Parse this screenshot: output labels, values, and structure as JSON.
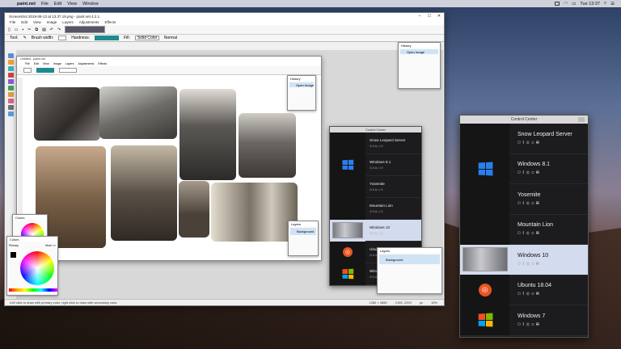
{
  "menubar": {
    "app": "paint.net",
    "items": [
      "File",
      "Edit",
      "View",
      "Window"
    ],
    "clock": "Tue 13:37"
  },
  "pdn": {
    "title": "Screenshot 2019-08-13 at 13.37.19.png - paint.net 4.2.1",
    "menu": [
      "File",
      "Edit",
      "View",
      "Image",
      "Layers",
      "Adjustments",
      "Effects"
    ],
    "toolbar": {
      "tool_label": "Tool:",
      "brush_width_label": "Brush width:",
      "brush_width": "15",
      "hardness_label": "Hardness:",
      "fill_label": "Fill:",
      "fill_value": "Solid Color",
      "blend_value": "Normal"
    },
    "status_left": "Left click to draw with primary color, right click to draw with secondary color.",
    "status_size": "1280 × 2880",
    "status_pos": "2195, 2293",
    "status_unit": "px",
    "status_zoom": "15%"
  },
  "history_top": {
    "title": "History",
    "item": "Open Image"
  },
  "nested": {
    "title": "Untitled - paint.net",
    "menu": [
      "File",
      "Edit",
      "View",
      "Image",
      "Layers",
      "Adjustments",
      "Effects"
    ],
    "history_title": "History",
    "history_item": "Open Image",
    "layers_title": "Layers",
    "layers_item": "Background"
  },
  "colors": {
    "title": "Colors",
    "primary": "Primary",
    "more": "More >>"
  },
  "layers_small": {
    "title": "Layers",
    "item": "Background"
  },
  "cc_small": {
    "title": "Control Center",
    "items": [
      {
        "name": "Snow Leopard Server",
        "sub": "⏻ ‖ ⚙ ⊘ ▤"
      },
      {
        "name": "Windows 8.1",
        "sub": "⏻ ‖ ⚙ ⊘ ▤"
      },
      {
        "name": "Yosemite",
        "sub": "⏻ ‖ ⚙ ⊘ ▤"
      },
      {
        "name": "Mountain Lion",
        "sub": "⏻ ‖ ⚙ ⊘ ▤"
      },
      {
        "name": "Windows 10",
        "sub": "⏻ ‖ ⚙ ⊘ ▤"
      },
      {
        "name": "Ubuntu 18.04",
        "sub": "⏻ ‖ ⚙ ⊘ ▤"
      },
      {
        "name": "Windows 7",
        "sub": "⏻ ‖ ⚙ ⊘ ▤"
      }
    ]
  },
  "cc_large": {
    "title": "Control Center",
    "items": [
      {
        "name": "Snow Leopard Server",
        "sub": "⏻ ‖ ⚙ ⊘ ▤"
      },
      {
        "name": "Windows 8.1",
        "sub": "⏻ ‖ ⚙ ⊘ ▤"
      },
      {
        "name": "Yosemite",
        "sub": "⏻ ‖ ⚙ ⊘ ▤"
      },
      {
        "name": "Mountain Lion",
        "sub": "⏻ ‖ ⚙ ⊘ ▤"
      },
      {
        "name": "Windows 10",
        "sub": "⏻ ‖ ⚙ ⊘ ▤"
      },
      {
        "name": "Ubuntu 18.04",
        "sub": "⏻ ‖ ⚙ ⊘ ▤"
      },
      {
        "name": "Windows 7",
        "sub": "⏻ ‖ ⚙ ⊘ ▤"
      }
    ]
  },
  "colors_accent": {
    "selection": "#d3dbee",
    "ubuntu": "#e95420",
    "windows": "#2a7ff0"
  }
}
